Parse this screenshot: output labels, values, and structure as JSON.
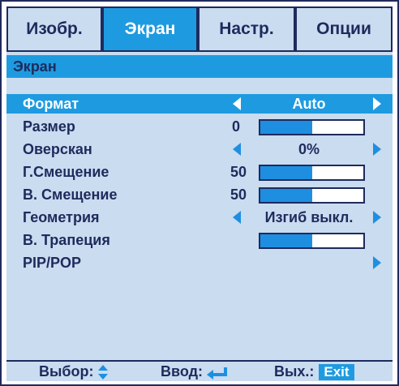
{
  "tabs": [
    {
      "label": "Изобр.",
      "active": false
    },
    {
      "label": "Экран",
      "active": true
    },
    {
      "label": "Настр.",
      "active": false
    },
    {
      "label": "Опции",
      "active": false
    }
  ],
  "section_title": "Экран",
  "menu": {
    "format": {
      "label": "Формат",
      "value": "Auto"
    },
    "size": {
      "label": "Размер",
      "value": "0",
      "level": 0.5
    },
    "overscan": {
      "label": "Оверскан",
      "value": "0%"
    },
    "hshift": {
      "label": "Г.Смещение",
      "value": "50",
      "level": 0.5
    },
    "vshift": {
      "label": "В. Смещение",
      "value": "50",
      "level": 0.5
    },
    "geometry": {
      "label": "Геометрия",
      "value": "Изгиб выкл."
    },
    "keystone": {
      "label": "В. Трапеция",
      "level": 0.5
    },
    "pip": {
      "label": "PIP/POP"
    }
  },
  "footer": {
    "select_label": "Выбор:",
    "enter_label": "Ввод:",
    "exit_label": "Вых.:",
    "exit_key": "Exit"
  },
  "colors": {
    "accent": "#1e9be0",
    "panel": "#c9dcf0",
    "text": "#1f2a5c"
  }
}
